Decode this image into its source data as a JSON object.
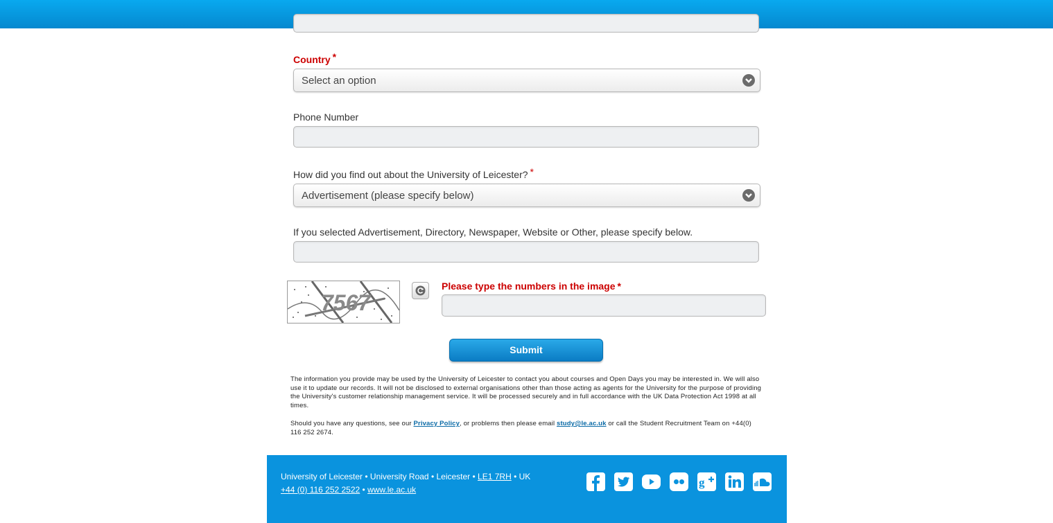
{
  "form": {
    "country": {
      "label": "Country",
      "required_mark": "*",
      "selected": "Select an option"
    },
    "phone": {
      "label": "Phone Number",
      "value": ""
    },
    "source": {
      "label": "How did you find out about the University of Leicester?",
      "required_mark": "*",
      "selected": "Advertisement (please specify below)"
    },
    "specify": {
      "label": "If you selected Advertisement, Directory, Newspaper, Website or Other, please specify below.",
      "value": ""
    },
    "captcha": {
      "label": "Please type the numbers in the image",
      "required_mark": "*",
      "image_text": "7567",
      "value": ""
    },
    "submit_label": "Submit"
  },
  "disclaimer": {
    "paragraph1": "The information you provide may be used by the University of Leicester to contact you about courses and Open Days you may be interested in. We will also use it to update our records. It will not be disclosed to external organisations other than those acting as agents for the University for the purpose of providing the University's customer relationship management service. It will be processed securely and in full accordance with the UK Data Protection Act 1998 at all times.",
    "p2_before": "Should you have any questions, see our ",
    "privacy_link": "Privacy Policy",
    "p2_middle": ", or problems then please email ",
    "email_link": "study@le.ac.uk",
    "p2_after": " or call the Student Recruitment Team on +44(0) 116 252 2674."
  },
  "footer": {
    "address_prefix": "University of Leicester • University Road • Leicester • ",
    "postcode": "LE1 7RH",
    "address_suffix": " • UK",
    "phone": "+44 (0) 116 252 2522",
    "separator": " • ",
    "website": "www.le.ac.uk",
    "social_icons": [
      "facebook-icon",
      "twitter-icon",
      "youtube-icon",
      "flickr-icon",
      "google-plus-icon",
      "linkedin-icon",
      "soundcloud-icon"
    ]
  },
  "colors": {
    "header_blue": "#0588cf",
    "required_red": "#cc0000",
    "footer_blue": "#0a93de",
    "link_blue": "#0a6aa6"
  }
}
